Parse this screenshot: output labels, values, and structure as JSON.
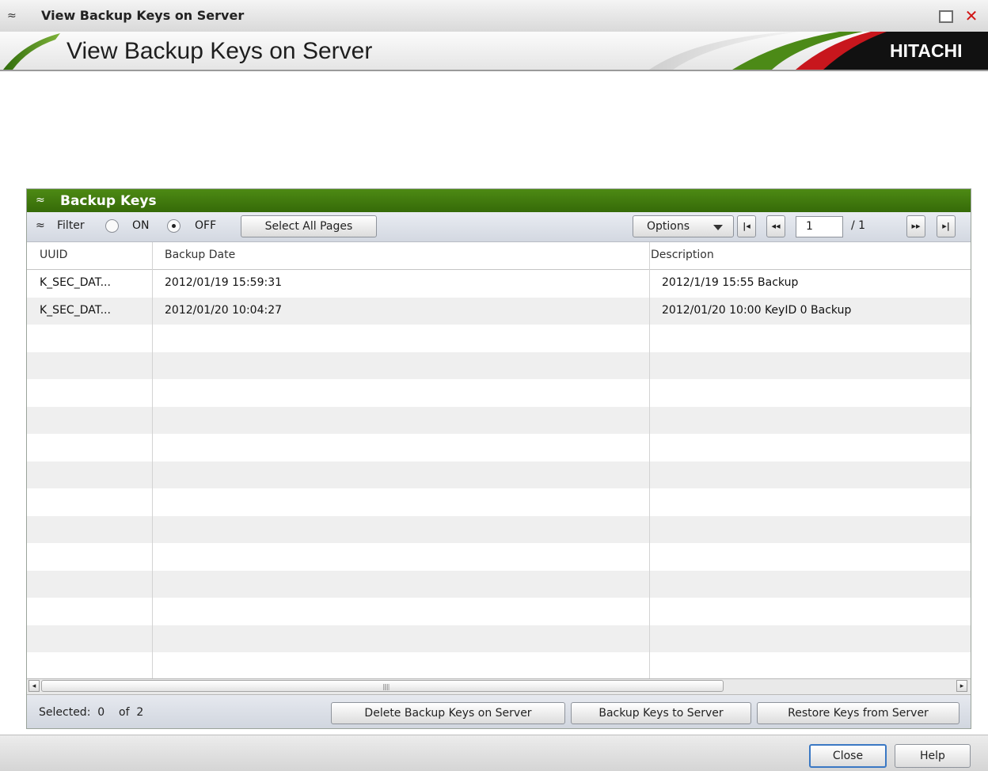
{
  "window": {
    "title": "View Backup Keys on Server",
    "collapse_icon": "double-chevron-up-icon",
    "max_icon": "maximize-icon",
    "close_glyph": "✕"
  },
  "banner": {
    "heading": "View Backup Keys on Server",
    "logo": "HITACHI",
    "accent_colors": [
      "#5a8f1c",
      "#c8161d"
    ]
  },
  "panel": {
    "title": "Backup Keys",
    "header_color": "#3e7a0d",
    "toolbar": {
      "filter_label": "Filter",
      "filter_on_label": "ON",
      "filter_off_label": "OFF",
      "filter_selected": "OFF",
      "select_all_label": "Select All Pages",
      "options_label": "Options",
      "first_glyph": "|◂",
      "prev_glyph": "◂◂",
      "next_glyph": "▸▸",
      "last_glyph": "▸|",
      "page_value": "1",
      "page_total": "/ 1"
    },
    "table": {
      "columns": [
        "UUID",
        "Backup Date",
        "Description"
      ],
      "rows": [
        {
          "uuid": "K_SEC_DAT...",
          "date": "2012/01/19 15:59:31",
          "description": "2012/1/19 15:55 Backup"
        },
        {
          "uuid": "K_SEC_DAT...",
          "date": "2012/01/20 10:04:27",
          "description": "2012/01/20 10:00 KeyID 0 Backup"
        }
      ]
    },
    "footer": {
      "selected_text": "Selected:  0    of  2",
      "delete_label": "Delete Backup Keys on Server",
      "backup_label": "Backup Keys to Server",
      "restore_label": "Restore Keys from Server"
    }
  },
  "bottom": {
    "close_label": "Close",
    "help_label": "Help"
  }
}
